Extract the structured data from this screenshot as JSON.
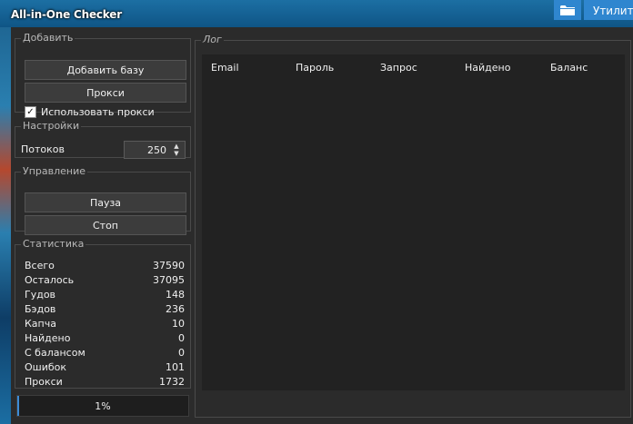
{
  "window": {
    "title": "All-in-One Checker"
  },
  "toolbar": {
    "utilities_label": "Утилиты",
    "folder_icon": "folder-icon"
  },
  "add_group": {
    "legend": "Добавить",
    "add_base_label": "Добавить базу",
    "proxy_label": "Прокси",
    "use_proxy_label": "Использовать прокси",
    "use_proxy_checked": true
  },
  "settings_group": {
    "legend": "Настройки",
    "threads_label": "Потоков",
    "threads_value": "250"
  },
  "control_group": {
    "legend": "Управление",
    "pause_label": "Пауза",
    "stop_label": "Стоп"
  },
  "stats_group": {
    "legend": "Статистика",
    "rows": [
      {
        "label": "Всего",
        "value": "37590"
      },
      {
        "label": "Осталось",
        "value": "37095"
      },
      {
        "label": "Гудов",
        "value": "148"
      },
      {
        "label": "Бэдов",
        "value": "236"
      },
      {
        "label": "Капча",
        "value": "10"
      },
      {
        "label": "Найдено",
        "value": "0"
      },
      {
        "label": "С балансом",
        "value": "0"
      },
      {
        "label": "Ошибок",
        "value": "101"
      },
      {
        "label": "Прокси",
        "value": "1732"
      }
    ]
  },
  "progress": {
    "text": "1%",
    "value": 0.01
  },
  "log_group": {
    "legend": "Лог",
    "columns": [
      "Email",
      "Пароль",
      "Запрос",
      "Найдено",
      "Баланс"
    ]
  },
  "colors": {
    "accent": "#2f86cf",
    "titlebar": "#0f5586",
    "panel": "#2b2b2b"
  }
}
